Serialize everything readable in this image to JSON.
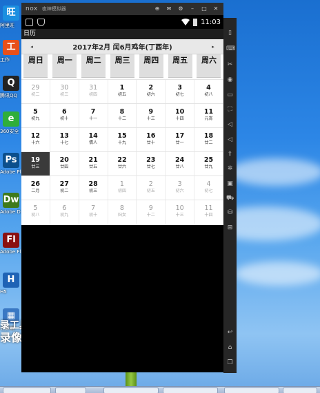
{
  "emulator": {
    "brand": "nox",
    "title": "夜神模拟器",
    "status_time": "11:03"
  },
  "app": {
    "title": "日历"
  },
  "calendar": {
    "month_title": "2017年2月 闰6月鸡年(丁酉年)",
    "prev_arrow": "◂",
    "next_arrow": "▸",
    "weekdays": [
      "周日",
      "周一",
      "周二",
      "周三",
      "周四",
      "周五",
      "周六"
    ],
    "weeks": [
      [
        {
          "day": "29",
          "lunar": "初二",
          "other": true
        },
        {
          "day": "30",
          "lunar": "初三",
          "other": true
        },
        {
          "day": "31",
          "lunar": "初四",
          "other": true
        },
        {
          "day": "1",
          "lunar": "初五",
          "other": false
        },
        {
          "day": "2",
          "lunar": "初六",
          "other": false
        },
        {
          "day": "3",
          "lunar": "初七",
          "other": false
        },
        {
          "day": "4",
          "lunar": "初八",
          "other": false
        }
      ],
      [
        {
          "day": "5",
          "lunar": "初九",
          "other": false
        },
        {
          "day": "6",
          "lunar": "初十",
          "other": false
        },
        {
          "day": "7",
          "lunar": "十一",
          "other": false
        },
        {
          "day": "8",
          "lunar": "十二",
          "other": false
        },
        {
          "day": "9",
          "lunar": "十三",
          "other": false
        },
        {
          "day": "10",
          "lunar": "十四",
          "other": false
        },
        {
          "day": "11",
          "lunar": "元宵",
          "other": false
        }
      ],
      [
        {
          "day": "12",
          "lunar": "十六",
          "other": false
        },
        {
          "day": "13",
          "lunar": "十七",
          "other": false
        },
        {
          "day": "14",
          "lunar": "情人",
          "other": false
        },
        {
          "day": "15",
          "lunar": "十九",
          "other": false
        },
        {
          "day": "16",
          "lunar": "廿十",
          "other": false
        },
        {
          "day": "17",
          "lunar": "廿一",
          "other": false
        },
        {
          "day": "18",
          "lunar": "廿二",
          "other": false
        }
      ],
      [
        {
          "day": "19",
          "lunar": "廿三",
          "other": false,
          "today": true
        },
        {
          "day": "20",
          "lunar": "廿四",
          "other": false
        },
        {
          "day": "21",
          "lunar": "廿五",
          "other": false
        },
        {
          "day": "22",
          "lunar": "廿六",
          "other": false
        },
        {
          "day": "23",
          "lunar": "廿七",
          "other": false
        },
        {
          "day": "24",
          "lunar": "廿八",
          "other": false
        },
        {
          "day": "25",
          "lunar": "廿九",
          "other": false
        }
      ],
      [
        {
          "day": "26",
          "lunar": "二月",
          "other": false
        },
        {
          "day": "27",
          "lunar": "初二",
          "other": false
        },
        {
          "day": "28",
          "lunar": "初三",
          "other": false
        },
        {
          "day": "1",
          "lunar": "初四",
          "other": true
        },
        {
          "day": "2",
          "lunar": "初五",
          "other": true
        },
        {
          "day": "3",
          "lunar": "初六",
          "other": true
        },
        {
          "day": "4",
          "lunar": "初七",
          "other": true
        }
      ],
      [
        {
          "day": "5",
          "lunar": "初八",
          "other": true
        },
        {
          "day": "6",
          "lunar": "初九",
          "other": true
        },
        {
          "day": "7",
          "lunar": "初十",
          "other": true
        },
        {
          "day": "8",
          "lunar": "妇女",
          "other": true
        },
        {
          "day": "9",
          "lunar": "十二",
          "other": true
        },
        {
          "day": "10",
          "lunar": "十三",
          "other": true
        },
        {
          "day": "11",
          "lunar": "十四",
          "other": true
        }
      ]
    ]
  },
  "desktop": {
    "icons": [
      {
        "label": "阿里旺",
        "icon": "aliwangwang-icon",
        "color": "#1b8fe0",
        "glyph": "旺"
      },
      {
        "label": "工作",
        "icon": "tool-icon",
        "color": "#e8501a",
        "glyph": "工"
      },
      {
        "label": "腾讯QQ",
        "icon": "qq-icon",
        "color": "#222222",
        "glyph": "Q"
      },
      {
        "label": "360安全",
        "icon": "shield-360-icon",
        "color": "#2fae3a",
        "glyph": "e"
      },
      {
        "label": "Adobe Photoshop",
        "icon": "photoshop-icon",
        "color": "#0c4f8c",
        "glyph": "Ps"
      },
      {
        "label": "Adobe Dreamweaver",
        "icon": "dreamweaver-icon",
        "color": "#3f7a1b",
        "glyph": "Dw"
      },
      {
        "label": "Adobe Flash",
        "icon": "flash-icon",
        "color": "#8a1010",
        "glyph": "Fl"
      },
      {
        "label": "H5",
        "icon": "help-icon",
        "color": "#1f63b5",
        "glyph": "H"
      },
      {
        "label": "计算器",
        "icon": "calculator-icon",
        "color": "#3a78c3",
        "glyph": "▦"
      }
    ],
    "watermark_line1": "录工具",
    "watermark_line2": "录像机"
  }
}
